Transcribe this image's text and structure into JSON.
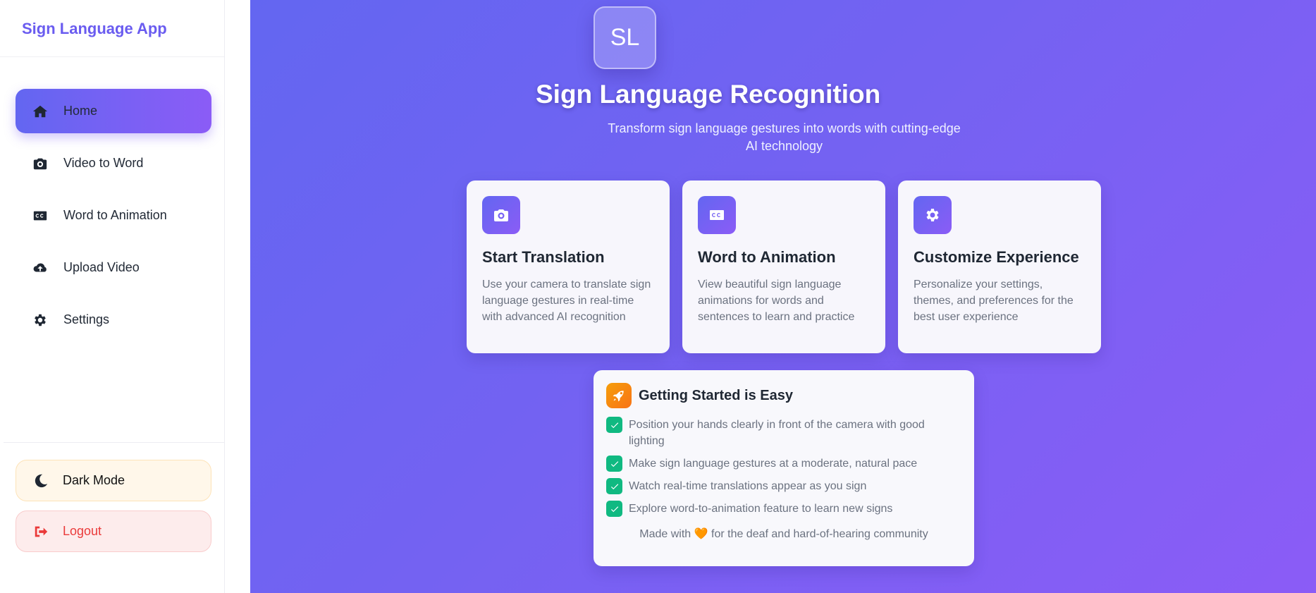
{
  "sidebar": {
    "brand": "Sign Language App",
    "items": [
      {
        "label": "Home",
        "icon": "home-icon",
        "active": true
      },
      {
        "label": "Video to Word",
        "icon": "camera-icon"
      },
      {
        "label": "Word to Animation",
        "icon": "closed-captions-icon"
      },
      {
        "label": "Upload Video",
        "icon": "cloud-upload-icon"
      },
      {
        "label": "Settings",
        "icon": "gear-icon"
      }
    ],
    "dark_mode_label": "Dark Mode",
    "logout_label": "Logout"
  },
  "hero": {
    "logo_text": "SL",
    "title": "Sign Language Recognition",
    "subtitle": "Transform sign language gestures into words with cutting-edge AI technology"
  },
  "cards": [
    {
      "icon": "camera-icon",
      "title": "Start Translation",
      "text": "Use your camera to translate sign language gestures in real-time with advanced AI recognition"
    },
    {
      "icon": "closed-captions-icon",
      "title": "Word to Animation",
      "text": "View beautiful sign language animations for words and sentences to learn and practice"
    },
    {
      "icon": "gear-icon",
      "title": "Customize Experience",
      "text": "Personalize your settings, themes, and preferences for the best user experience"
    }
  ],
  "guide": {
    "icon": "rocket-icon",
    "title": "Getting Started is Easy",
    "steps": [
      "Position your hands clearly in front of the camera with good lighting",
      "Make sign language gestures at a moderate, natural pace",
      "Watch real-time translations appear as you sign",
      "Explore word-to-animation feature to learn new signs"
    ],
    "footer_before": "Made with",
    "footer_heart": "🧡",
    "footer_after": "for the deaf and hard-of-hearing community"
  },
  "colors": {
    "accent": "#6366f1",
    "accent2": "#8b5cf6",
    "check": "#10b981",
    "logout": "#ea3a3a"
  }
}
